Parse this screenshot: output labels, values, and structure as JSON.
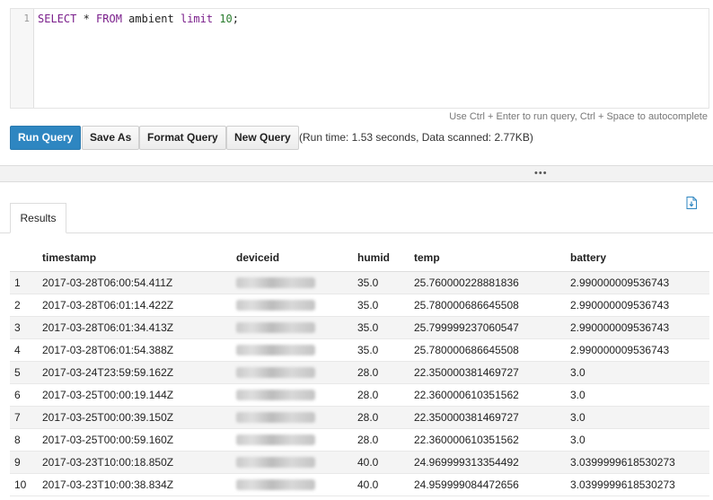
{
  "editor": {
    "line_number": "1",
    "query": {
      "select": "SELECT",
      "star": " * ",
      "from": "FROM",
      "table": " ambient ",
      "limit": "limit",
      "num": " 10",
      "end": ";"
    },
    "hint": "Use Ctrl + Enter to run query, Ctrl + Space to autocomplete"
  },
  "toolbar": {
    "run": "Run Query",
    "save": "Save As",
    "format": "Format Query",
    "new": "New Query",
    "runtime": "(Run time: 1.53 seconds, Data scanned: 2.77KB)"
  },
  "divider": {
    "grip": "•••"
  },
  "results": {
    "tab": "Results",
    "export_icon": "download-file-icon",
    "columns": [
      "",
      "timestamp",
      "deviceid",
      "humid",
      "temp",
      "battery"
    ],
    "rows": [
      [
        "1",
        "2017-03-28T06:00:54.411Z",
        "35.0",
        "25.760000228881836",
        "2.990000009536743"
      ],
      [
        "2",
        "2017-03-28T06:01:14.422Z",
        "35.0",
        "25.780000686645508",
        "2.990000009536743"
      ],
      [
        "3",
        "2017-03-28T06:01:34.413Z",
        "35.0",
        "25.799999237060547",
        "2.990000009536743"
      ],
      [
        "4",
        "2017-03-28T06:01:54.388Z",
        "35.0",
        "25.780000686645508",
        "2.990000009536743"
      ],
      [
        "5",
        "2017-03-24T23:59:59.162Z",
        "28.0",
        "22.350000381469727",
        "3.0"
      ],
      [
        "6",
        "2017-03-25T00:00:19.144Z",
        "28.0",
        "22.360000610351562",
        "3.0"
      ],
      [
        "7",
        "2017-03-25T00:00:39.150Z",
        "28.0",
        "22.350000381469727",
        "3.0"
      ],
      [
        "8",
        "2017-03-25T00:00:59.160Z",
        "28.0",
        "22.360000610351562",
        "3.0"
      ],
      [
        "9",
        "2017-03-23T10:00:18.850Z",
        "40.0",
        "24.969999313354492",
        "3.0399999618530273"
      ],
      [
        "10",
        "2017-03-23T10:00:38.834Z",
        "40.0",
        "24.959999084472656",
        "3.0399999618530273"
      ]
    ]
  },
  "colors": {
    "primary": "#2e86c1",
    "keyword": "#7a1e8b",
    "number": "#2a7d2e"
  }
}
